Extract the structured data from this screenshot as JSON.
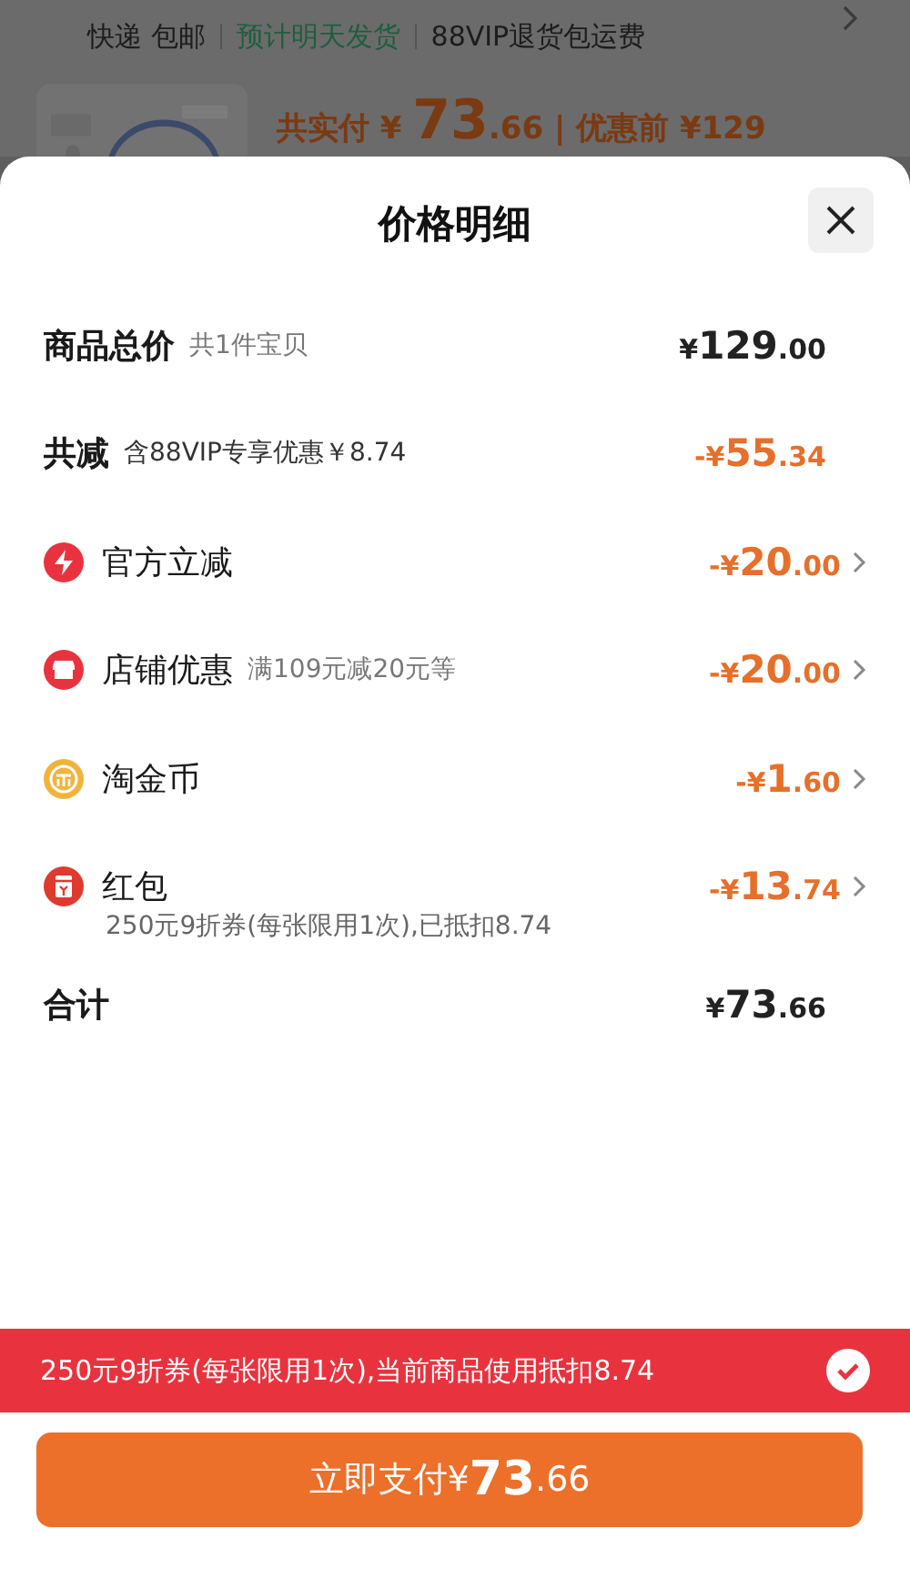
{
  "background": {
    "shipping": [
      {
        "text": "快递 包邮",
        "kind": "plain"
      },
      {
        "text": "预计明天发货",
        "kind": "green"
      },
      {
        "text": "88VIP退货包运费",
        "kind": "plain"
      }
    ],
    "price_line": "共实付 ¥ **73**.66 | 优惠前 ¥129"
  },
  "sheet": {
    "title": "价格明细",
    "rows": [
      {
        "kind": "total",
        "label": "商品总价",
        "note": "共1件宝贝",
        "amount": "¥**129**.00"
      },
      {
        "kind": "reduce",
        "label": "共减",
        "note": "含88VIP专享优惠￥8.74",
        "amount": "-¥**55**.34"
      },
      {
        "kind": "item",
        "color": "#e8333f",
        "label": "官方立减",
        "amount": "-¥**20**.00"
      },
      {
        "kind": "item",
        "color": "#e8333f",
        "label": "店铺优惠",
        "note": "满109元减20元等",
        "amount": "-¥**20**.00"
      },
      {
        "kind": "item",
        "color": "#f0b43c",
        "label": "淘金币",
        "amount": "-¥**1**.60"
      },
      {
        "kind": "item",
        "color": "#e03a2f",
        "label": "红包",
        "amount": "-¥**13**.74",
        "detail": "250元9折券(每张限用1次),已抵扣8.74"
      },
      {
        "kind": "sum",
        "label": "合计",
        "amount": "¥**73**.66"
      }
    ]
  },
  "coupon_banner": {
    "text": "250元9折券(每张限用1次),当前商品使用抵扣8.74",
    "checked": true
  },
  "pay_button": "立即支付¥**73**.66"
}
